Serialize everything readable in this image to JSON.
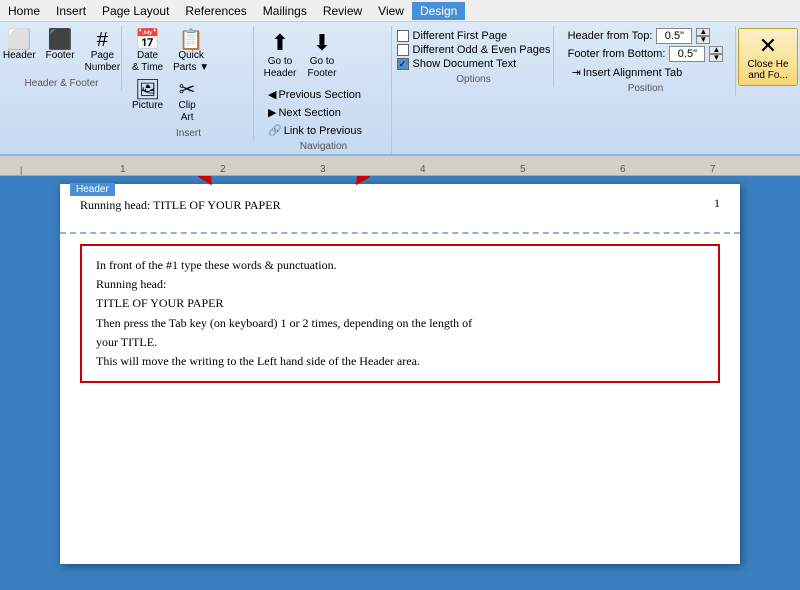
{
  "menu": {
    "items": [
      "Home",
      "Insert",
      "Page Layout",
      "References",
      "Mailings",
      "Review",
      "View",
      "Design"
    ],
    "active": "Design"
  },
  "ribbon": {
    "groups": {
      "header_footer": {
        "label": "Header & Footer",
        "buttons": [
          "Header",
          "Footer",
          "Page\nNumber"
        ]
      },
      "insert": {
        "label": "Insert",
        "buttons": [
          "Date\n& Time",
          "Quick\nParts▼",
          "Picture",
          "Clip\nArt"
        ]
      },
      "navigation": {
        "label": "Navigation",
        "items": [
          "Go to\nHeader",
          "Go to\nFooter"
        ],
        "links": [
          "Previous Section",
          "Next Section",
          "Link to Previous"
        ]
      },
      "options": {
        "label": "Options",
        "checkboxes": [
          {
            "label": "Different First Page",
            "checked": false
          },
          {
            "label": "Different Odd & Even Pages",
            "checked": false
          },
          {
            "label": "Show Document Text",
            "checked": true
          }
        ]
      },
      "position": {
        "label": "Position",
        "fields": [
          {
            "label": "Header from Top:",
            "value": "0.5\""
          },
          {
            "label": "Footer from Bottom:",
            "value": "0.5\""
          },
          {
            "label": "Insert Alignment Tab",
            "isLink": true
          }
        ]
      },
      "close": {
        "label": "",
        "btn_label": "Close He\nand Fo..."
      }
    }
  },
  "ruler": {
    "marks": [
      "1",
      "2",
      "3",
      "4",
      "5",
      "6",
      "7"
    ]
  },
  "page": {
    "running_head": "Running head: TITLE OF YOUR PAPER",
    "page_number": "1",
    "header_label": "Header",
    "instruction_lines": [
      "In front of the #1 type these words & punctuation.",
      "Running head:",
      "TITLE OF YOUR PAPER",
      "Then press the Tab key (on keyboard) 1 or 2 times, depending on the length of",
      "your TITLE.",
      "This will move the writing to the Left hand side of the Header area."
    ]
  }
}
